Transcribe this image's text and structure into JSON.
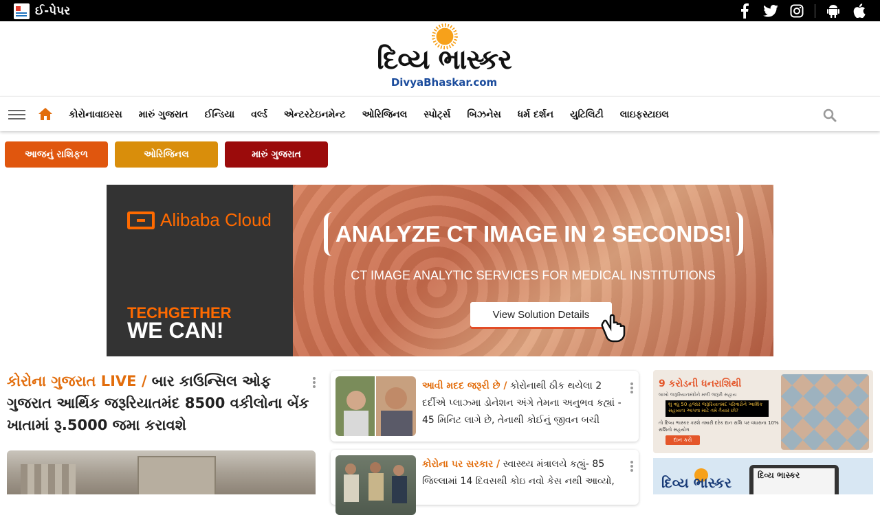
{
  "topbar": {
    "epaper_label": "ઈ-પેપર",
    "social": [
      "facebook-icon",
      "twitter-icon",
      "instagram-icon",
      "android-icon",
      "apple-icon"
    ]
  },
  "logo": {
    "title_gu": "દિવ્ય ભાસ્કર",
    "domain": "DivyaBhaskar.com"
  },
  "nav": {
    "items": [
      "કોરોનાવાઇરસ",
      "મારું ગુજરાત",
      "ઈન્ડિયા",
      "વર્લ્ડ",
      "એન્ટરટેઇનમેન્ટ",
      "ઓરિજિનલ",
      "સ્પોર્ટ્સ",
      "બિઝનેસ",
      "ધર્મ દર્શન",
      "યુટિલિટી",
      "લાઇફસ્ટાઇલ"
    ]
  },
  "pills": [
    {
      "label": "આજનું રાશિફળ",
      "color": "#e0560e"
    },
    {
      "label": "ઓરિજિનલ",
      "color": "#d98e0b"
    },
    {
      "label": "મારું ગુજરાત",
      "color": "#9b0b0b"
    }
  ],
  "ad": {
    "brand": "Alibaba Cloud",
    "tag_line1": "TECHGETHER",
    "tag_line2": "WE CAN!",
    "headline": "ANALYZE CT IMAGE IN 2 SECONDS!",
    "subline": "CT IMAGE ANALYTIC SERVICES FOR MEDICAL INSTITUTIONS",
    "button": "View Solution Details"
  },
  "lead": {
    "kicker": "કોરોના ગુજરાત LIVE /",
    "title": " બાર કાઉન્સિલ ઓફ ગુજરાત આર્થિક જરૂરિયાતમંદ 8500 વકીલોના બેંક ખાતામાં રૂ.5000 જમા કરાવશે"
  },
  "stories": [
    {
      "kicker": "આવી મદદ જરૂરી છે /",
      "title": " કોરોનાથી ઠીક થયેલા 2 દર્દીએ પ્લાઝ્મા ડોનેશન અંગે તેમના અનુભવ કહ્યાં - 45 મિનિટ લાગે છે, તેનાથી કોઈનું જીવન બચી"
    },
    {
      "kicker": "કોરોના પર સરકાર /",
      "title": " સ્વાસ્થ્ય મંત્રાલયે કહ્યું- 85 જિલ્લામાં 14 દિવસથી કોઇ નવો કેસ નથી આવ્યો,"
    }
  ],
  "promo1": {
    "title": "9 કરોડની ધનરાશિથી",
    "sub": "લાખો જરૂરિયાતમંદોને મળી જરૂરી સહાય",
    "box": "શું વધુ 50 હજાર જરૂરિયાતમંદ પરિવારોને આર્થિક સહાયતા આપવા માટે તમે તૈયાર છો?",
    "note": "તો દિવ્ય ભાસ્કર કરશે તમારી દરેક દાન રાશિ પર વધારાના 10% રાશિનો સહયોગ",
    "button": "દાન કરો"
  },
  "promo2": {
    "logo": "દિવ્ય ભાસ્કર",
    "screen": "દિવ્ય ભાસ્કર"
  }
}
